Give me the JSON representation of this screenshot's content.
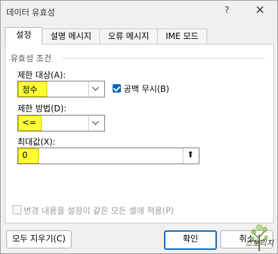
{
  "window": {
    "title": "데이터 유효성",
    "help_glyph": "?",
    "close_glyph": "✕"
  },
  "tabs": [
    {
      "label": "설정",
      "active": true
    },
    {
      "label": "설명 메시지",
      "active": false
    },
    {
      "label": "오류 메시지",
      "active": false
    },
    {
      "label": "IME 모드",
      "active": false
    }
  ],
  "settings": {
    "group_title": "유효성 조건",
    "allow_label": "제한 대상(A):",
    "allow_value": "정수",
    "ignore_blank_label": "공백 무시(B)",
    "ignore_blank_checked": true,
    "data_label": "제한 방법(D):",
    "data_value": "<=",
    "max_label": "최대값(X):",
    "max_value": "0",
    "apply_all_label": "변경 내용을 설정이 같은 모든 셀에 적용(P)",
    "apply_all_checked": false
  },
  "footer": {
    "clear_all_label": "모두 지우기(C)",
    "ok_label": "확인",
    "cancel_label": "취소"
  },
  "watermark": {
    "text": "스토리지"
  },
  "colors": {
    "highlight": "#ffff33",
    "accent": "#0067c0"
  }
}
